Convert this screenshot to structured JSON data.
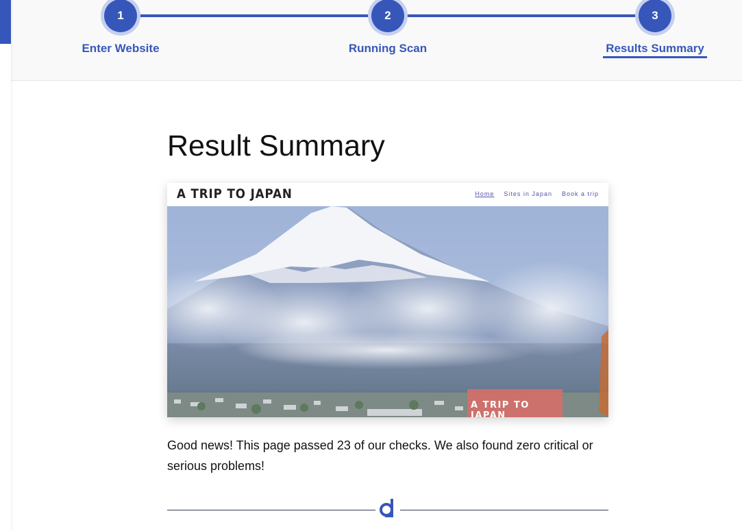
{
  "stepper": {
    "steps": [
      {
        "number": "1",
        "label": "Enter Website"
      },
      {
        "number": "2",
        "label": "Running Scan"
      },
      {
        "number": "3",
        "label": "Results Summary"
      }
    ],
    "current_step": 3,
    "accent_color": "#3657b9"
  },
  "main": {
    "title": "Result Summary",
    "preview": {
      "site_logo": "A TRIP TO JAPAN",
      "nav": [
        "Home",
        "Sites in Japan",
        "Book a trip"
      ],
      "badge_text": "A TRIP TO JAPAN"
    },
    "result_text": "Good news! This page passed 23 of our checks. We also found zero critical or serious problems!",
    "divider_icon": "brand-logo-icon"
  }
}
